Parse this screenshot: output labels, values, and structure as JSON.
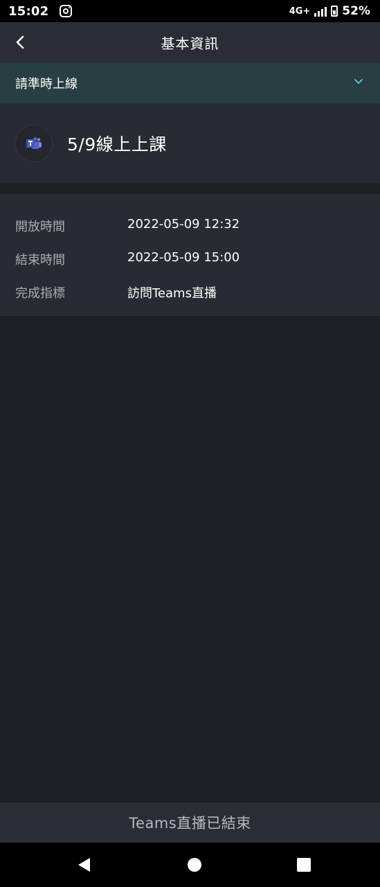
{
  "status_bar": {
    "time": "15:02",
    "app_icon": "instagram-icon",
    "network": "4G+",
    "battery": "52%"
  },
  "header": {
    "back_icon": "back-arrow-icon",
    "title": "基本資訊"
  },
  "section": {
    "label": "請準時上線",
    "chevron": "chevron-down-icon",
    "accent_color": "#4fc3c1"
  },
  "activity": {
    "icon": "teams-icon",
    "title": "5/9線上上課",
    "brand_color": "#5b5fc7"
  },
  "info": {
    "rows": [
      {
        "label": "開放時間",
        "value": "2022-05-09 12:32"
      },
      {
        "label": "結束時間",
        "value": "2022-05-09 15:00"
      },
      {
        "label": "完成指標",
        "value": "訪問Teams直播"
      }
    ]
  },
  "footer": {
    "status_text": "Teams直播已結束"
  },
  "nav_bar": {
    "back": "nav-back-icon",
    "home": "nav-home-icon",
    "recents": "nav-recents-icon"
  }
}
